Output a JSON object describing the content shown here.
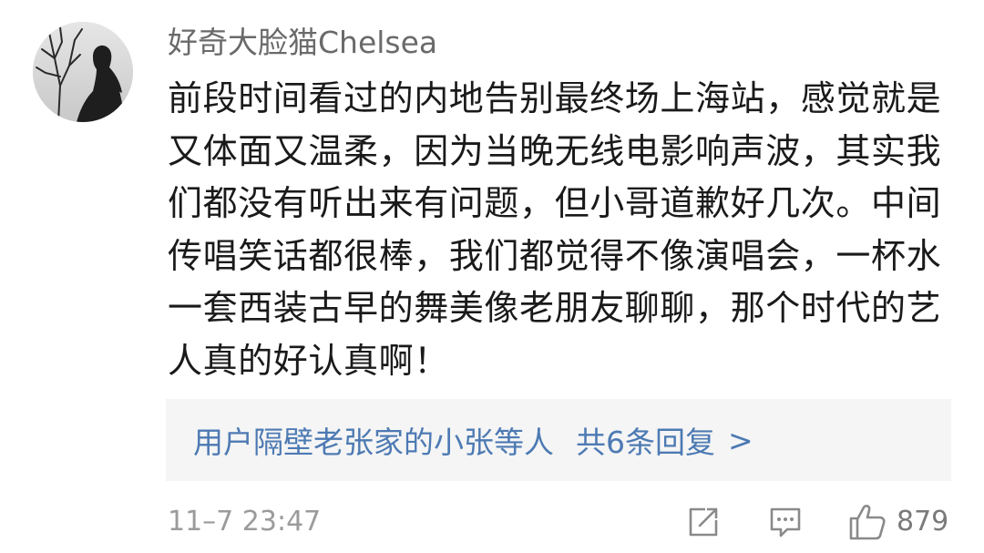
{
  "comment": {
    "username": "好奇大脸猫Chelsea",
    "text": "前段时间看过的内地告别最终场上海站，感觉就是又体面又温柔，因为当晚无线电影响声波，其实我们都没有听出来有问题，但小哥道歉好几次。中间传唱笑话都很棒，我们都觉得不像演唱会，一杯水一套西装古早的舞美像老朋友聊聊，那个时代的艺人真的好认真啊！",
    "avatar_icon": "avatar-silhouette-tree"
  },
  "replies": {
    "users": "用户隔壁老张家的小张等人",
    "count": "共6条回复",
    "chevron": ">"
  },
  "footer": {
    "timestamp": "11–7 23:47",
    "share_icon": "share-icon",
    "comment_icon": "comment-icon",
    "like_icon": "thumbs-up-icon",
    "like_count": "879"
  },
  "colors": {
    "link": "#4d7ab3",
    "username": "#6a6a6a",
    "body_text": "#1a1a1a",
    "muted": "#9b9b9b",
    "reply_bg": "#f5f5f5"
  }
}
